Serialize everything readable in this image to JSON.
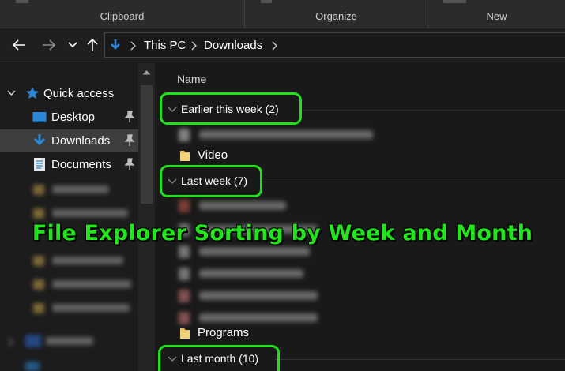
{
  "ribbon": {
    "groups": [
      "Clipboard",
      "Organize",
      "New"
    ]
  },
  "nav": {
    "breadcrumb": [
      "This PC",
      "Downloads"
    ]
  },
  "sidebar": {
    "quick_access": "Quick access",
    "items": [
      {
        "label": "Desktop",
        "icon": "desktop-icon",
        "pinned": true
      },
      {
        "label": "Downloads",
        "icon": "download-arrow-icon",
        "pinned": true,
        "selected": true
      },
      {
        "label": "Documents",
        "icon": "document-icon",
        "pinned": true
      }
    ]
  },
  "content": {
    "column_name": "Name",
    "groups": [
      {
        "label": "Earlier this week (2)",
        "files": [
          "Video"
        ]
      },
      {
        "label": "Last week (7)",
        "files": [
          "Programs"
        ]
      },
      {
        "label": "Last month (10)",
        "files": []
      }
    ]
  },
  "overlay": {
    "title": "File Explorer Sorting by Week and Month",
    "highlight_color": "#1fe01a"
  },
  "colors": {
    "background": "#191919",
    "accent_blue": "#2b88d8",
    "folder_yellow": "#e8c15a"
  }
}
